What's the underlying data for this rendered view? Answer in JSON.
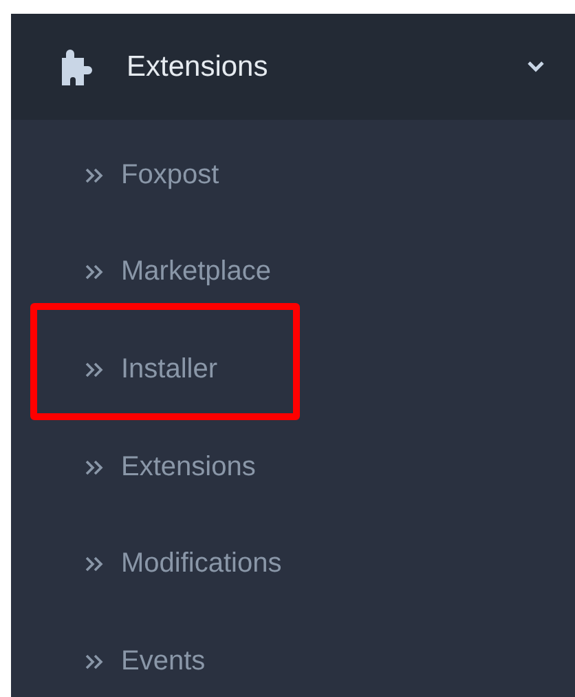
{
  "menu": {
    "title": "Extensions",
    "expanded": true,
    "items": [
      {
        "label": "Foxpost",
        "highlighted": false
      },
      {
        "label": "Marketplace",
        "highlighted": false
      },
      {
        "label": "Installer",
        "highlighted": true
      },
      {
        "label": "Extensions",
        "highlighted": false
      },
      {
        "label": "Modifications",
        "highlighted": false
      },
      {
        "label": "Events",
        "highlighted": false
      }
    ]
  }
}
